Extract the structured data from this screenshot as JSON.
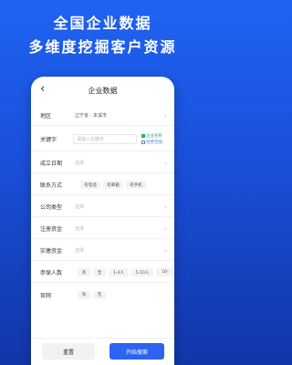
{
  "promo": {
    "line1": "全国企业数据",
    "line2": "多维度挖掘客户资源"
  },
  "app": {
    "back_glyph": "‹",
    "title": "企业数据"
  },
  "form": {
    "region": {
      "label": "地区",
      "value": "辽宁省 - 本溪市"
    },
    "keyword": {
      "label": "关键字",
      "placeholder": "请输入关键字",
      "options": [
        {
          "label": "企业名称",
          "checked": true
        },
        {
          "label": "经营范围",
          "checked": false
        }
      ]
    },
    "established": {
      "label": "成立日期",
      "placeholder": "选择"
    },
    "contact": {
      "label": "联系方式",
      "chips": [
        "有电话",
        "有邮箱",
        "有手机"
      ]
    },
    "company_type": {
      "label": "公司类型",
      "placeholder": "选择"
    },
    "reg_capital": {
      "label": "注册资金",
      "placeholder": "选择"
    },
    "paid_capital": {
      "label": "实缴资金",
      "placeholder": "选择"
    },
    "insured": {
      "label": "参保人数",
      "chips": [
        "有",
        "无",
        "1-4人",
        "5-10人",
        "10-"
      ]
    },
    "website": {
      "label": "官网",
      "chips": [
        "有",
        "无"
      ]
    }
  },
  "actions": {
    "reset": "重置",
    "search": "开始搜索"
  }
}
